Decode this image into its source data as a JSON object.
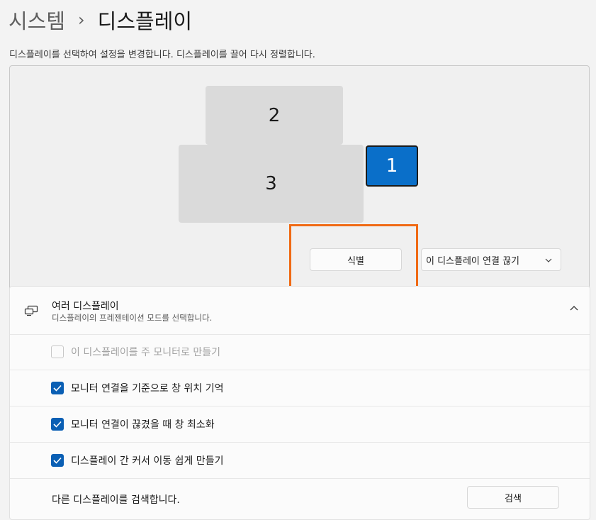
{
  "breadcrumb": {
    "parent": "시스템",
    "separator": "›",
    "current": "디스플레이"
  },
  "description": "디스플레이를 선택하여 설정을 변경합니다. 디스플레이를 끌어 다시 정렬합니다.",
  "monitors": [
    {
      "id": "2",
      "label": "2",
      "selected": false
    },
    {
      "id": "3",
      "label": "3",
      "selected": false
    },
    {
      "id": "1",
      "label": "1",
      "selected": true
    }
  ],
  "actions": {
    "identify": "식별",
    "disconnect": "이 디스플레이 연결 끊기"
  },
  "multiple_displays": {
    "title": "여러 디스플레이",
    "subtitle": "디스플레이의 프레젠테이션 모드를 선택합니다.",
    "options": [
      {
        "label": "이 디스플레이를 주 모니터로 만들기",
        "checked": false,
        "enabled": false
      },
      {
        "label": "모니터 연결을 기준으로 창 위치 기억",
        "checked": true,
        "enabled": true
      },
      {
        "label": "모니터 연결이 끊겼을 때 창 최소화",
        "checked": true,
        "enabled": true
      },
      {
        "label": "디스플레이 간 커서 이동 쉽게 만들기",
        "checked": true,
        "enabled": true
      }
    ],
    "detect_label": "다른 디스플레이를 검색합니다.",
    "detect_button": "검색"
  },
  "colors": {
    "accent": "#0a5fb4",
    "selected_monitor": "#0a6fc9",
    "highlight": "#f06a14"
  }
}
